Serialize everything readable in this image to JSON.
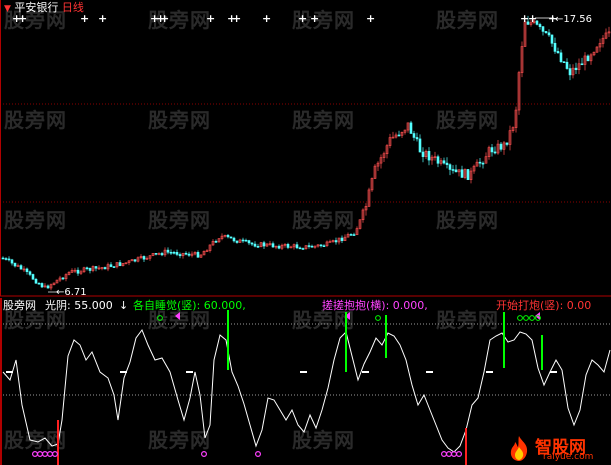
{
  "header": {
    "title_prefix": "平安银行",
    "title_suffix": "日线",
    "dropdown_icon": "triangle-down-icon"
  },
  "watermark_text": "股旁网",
  "price_panel": {
    "label_high": "17.56",
    "label_low": "6.71"
  },
  "indicator_bar": {
    "name": "股旁网",
    "line1": "光阴: 55.000",
    "arrow": "↓",
    "line2": "各自睡觉(竖): 60.000,",
    "line3": "搓搓抱抱(横): 0.000,",
    "line4": "开始打炮(竖): 0.00"
  },
  "brand": {
    "title": "智股网",
    "url": "raiyue.com"
  },
  "colors": {
    "background": "#000000",
    "up_candle": "#ff5050",
    "down_candle": "#54ffff",
    "grid": "#8a0000",
    "oscillator_line": "#ffffff",
    "green_signal": "#00ff00",
    "magenta_signal": "#ff40ff",
    "red_signal": "#ff2020",
    "title_text": "#ffffff",
    "title_accent": "#ff3333",
    "green_text": "#00ff00",
    "magenta_text": "#ff44ff",
    "red_text": "#ff3333"
  }
}
